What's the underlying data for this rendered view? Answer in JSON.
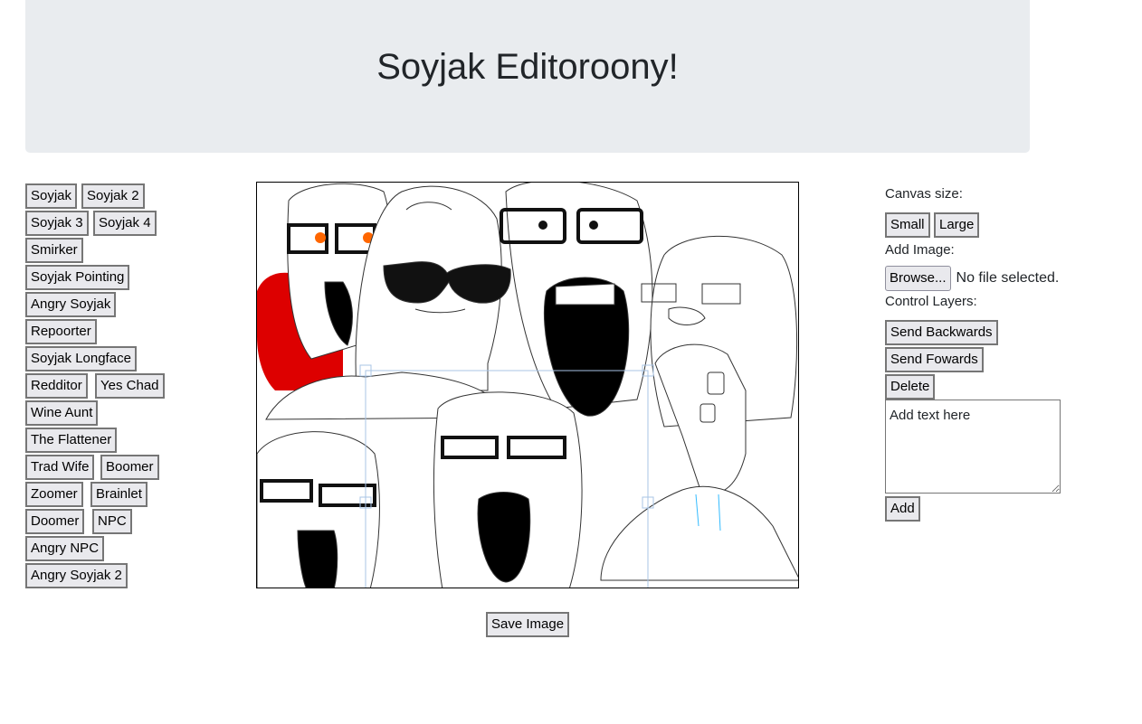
{
  "header": {
    "title": "Soyjak Editoroony!"
  },
  "characters": [
    "Soyjak",
    "Soyjak 2",
    "Soyjak 3",
    "Soyjak 4",
    "Smirker",
    "Soyjak Pointing",
    "Angry Soyjak",
    "Repoorter",
    "Soyjak Longface",
    "Redditor",
    "Yes Chad",
    "Wine Aunt",
    "The Flattener",
    "Trad Wife",
    "Boomer",
    "Zoomer",
    "Brainlet",
    "Doomer",
    "NPC",
    "Angry NPC",
    "Angry Soyjak 2"
  ],
  "controls": {
    "canvas_size_label": "Canvas size:",
    "small_label": "Small",
    "large_label": "Large",
    "add_image_label": "Add Image:",
    "browse_label": "Browse...",
    "no_file_text": "No file selected.",
    "control_layers_label": "Control Layers:",
    "send_backwards_label": "Send Backwards",
    "send_forwards_label": "Send Fowards",
    "delete_label": "Delete",
    "text_placeholder": "Add text here",
    "add_label": "Add"
  },
  "footer": {
    "save_label": "Save Image"
  },
  "colors": {
    "header_bg": "#e9ecef",
    "accent_red": "#dd0000",
    "selection_blue": "#a8c4e6"
  }
}
